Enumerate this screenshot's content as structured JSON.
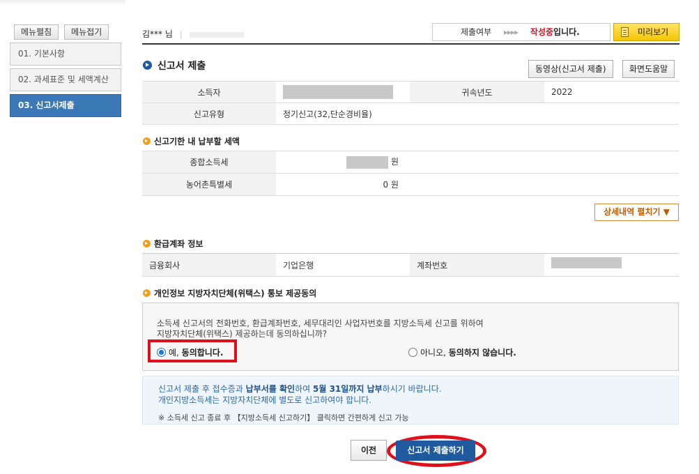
{
  "menu_buttons": {
    "expand": "메뉴펼침",
    "collapse": "메뉴접기"
  },
  "sidebar": {
    "items": [
      {
        "label": "01. 기본사항",
        "active": false
      },
      {
        "label": "02. 과세표준 및 세액계산",
        "active": false
      },
      {
        "label": "03. 신고서제출",
        "active": true
      }
    ]
  },
  "header": {
    "user_name": "김***",
    "user_suffix": "님",
    "status_label": "제출여부",
    "status_arrows": "▸▸▸▸",
    "status_value": "작성중",
    "status_suffix": "입니다.",
    "preview_label": "미리보기"
  },
  "section": {
    "title": "신고서 제출",
    "video_button": "동영상(신고서 제출)",
    "help_button": "화면도움말"
  },
  "info_table": {
    "taxpayer_label": "소득자",
    "year_label": "귀속년도",
    "year_value": "2022",
    "type_label": "신고유형",
    "type_value": "정기신고(32,단순경비율)"
  },
  "tax_section": {
    "title": "신고기한 내 납부할 세액",
    "income_tax_label": "종합소득세",
    "income_tax_unit": "원",
    "rural_tax_label": "농어촌특별세",
    "rural_tax_value": "0 원",
    "detail_button": "상세내역 펼치기 ▼"
  },
  "refund_section": {
    "title": "환급계좌 정보",
    "bank_label": "금융회사",
    "bank_value": "기업은행",
    "account_label": "계좌번호"
  },
  "consent_section": {
    "title": "개인정보 지방자치단체(위택스) 통보 제공동의",
    "question_line1": "소득세 신고서의 전화번호, 환급계좌번호, 세무대리인 사업자번호를 지방소득세 신고를 위하여",
    "question_line2": "지방자치단체(위택스) 제공하는데 동의하십니까?",
    "yes_prefix": "예, ",
    "yes_bold": "동의합니다.",
    "no_prefix": "아니오, ",
    "no_bold": "동의하지 않습니다."
  },
  "notice": {
    "line1_a": "신고서 제출 후 접수증과 ",
    "line1_b": "납부서를 확인",
    "line1_c": "하여 ",
    "line1_d": "5월 31일까지 납부",
    "line1_e": "하시기 바랍니다.",
    "line2": "개인지방소득세는 지방자치단체에 별도로 신고하여야 합니다.",
    "line3": "※ 소득세 신고 종료 후 【지방소득세 신고하기】 클릭하면 간편하게 신고 가능"
  },
  "footer": {
    "prev_button": "이전",
    "submit_button": "신고서 제출하기"
  },
  "colors": {
    "accent_blue": "#1f5a9e",
    "status_red": "#dd1122",
    "highlight_red": "#e0101a",
    "preview_yellow": "#f3c600",
    "detail_orange": "#c55a00"
  }
}
